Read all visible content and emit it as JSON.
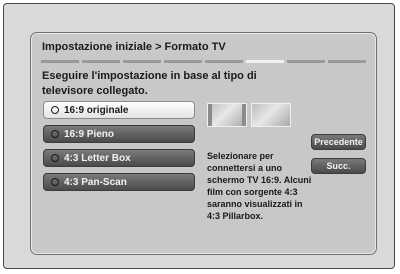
{
  "dialog": {
    "title": "Impostazione iniziale > Formato TV",
    "instruction": "Eseguire l'impostazione in base al tipo di televisore collegato.",
    "progress": {
      "total_steps": 8,
      "current_step": 6
    }
  },
  "options": [
    {
      "label": "16:9 originale",
      "selected": true
    },
    {
      "label": "16:9 Pieno",
      "selected": false
    },
    {
      "label": "4:3 Letter Box",
      "selected": false
    },
    {
      "label": "4:3 Pan-Scan",
      "selected": false
    }
  ],
  "description": "Selezionare per connettersi a uno schermo TV 16:9. Alcuni film con sorgente 4:3 saranno visualizzati in 4:3 Pillarbox.",
  "buttons": {
    "previous": "Precedente",
    "next": "Succ."
  }
}
